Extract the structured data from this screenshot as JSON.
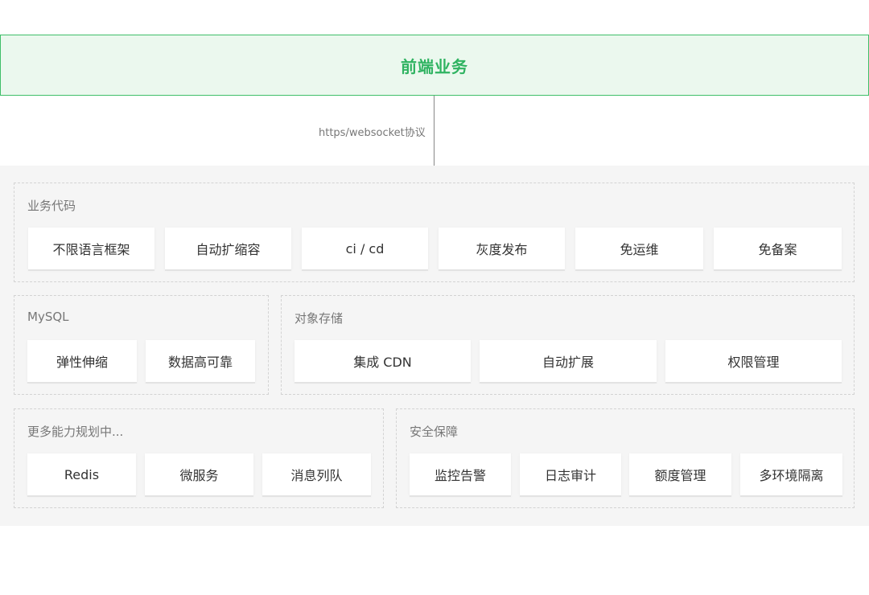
{
  "frontend": {
    "title": "前端业务"
  },
  "connector": {
    "label": "https/websocket协议"
  },
  "groups": {
    "business_code": {
      "title": "业务代码",
      "items": [
        "不限语言框架",
        "自动扩缩容",
        "ci / cd",
        "灰度发布",
        "免运维",
        "免备案"
      ]
    },
    "mysql": {
      "title": "MySQL",
      "items": [
        "弹性伸缩",
        "数据高可靠"
      ]
    },
    "object_storage": {
      "title": "对象存储",
      "items": [
        "集成 CDN",
        "自动扩展",
        "权限管理"
      ]
    },
    "planned": {
      "title": "更多能力规划中...",
      "items": [
        "Redis",
        "微服务",
        "消息列队"
      ]
    },
    "security": {
      "title": "安全保障",
      "items": [
        "监控告警",
        "日志审计",
        "额度管理",
        "多环境隔离"
      ]
    }
  },
  "colors": {
    "accent_green": "#2fb361",
    "frontend_bg": "#ebf8ee",
    "platform_bg": "#f5f5f5"
  }
}
